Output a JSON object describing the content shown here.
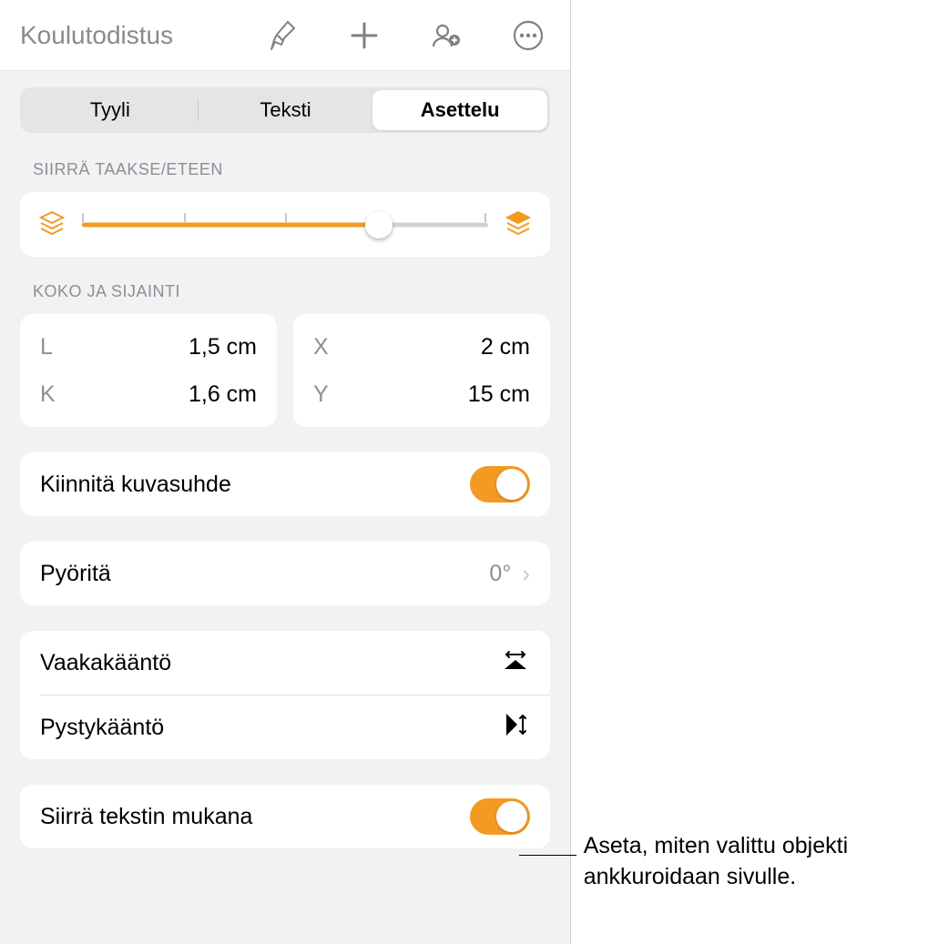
{
  "header": {
    "title": "Koulutodistus",
    "icons": {
      "format": "format-brush-icon",
      "add": "plus-icon",
      "collab": "collaborate-icon",
      "more": "more-icon"
    }
  },
  "tabs": {
    "style": "Tyyli",
    "text": "Teksti",
    "layout": "Asettelu"
  },
  "sections": {
    "move": "SIIRRÄ TAAKSE/ETEEN",
    "size": "KOKO JA SIJAINTI"
  },
  "size": {
    "w_label": "L",
    "w_value": "1,5 cm",
    "h_label": "K",
    "h_value": "1,6 cm",
    "x_label": "X",
    "x_value": "2 cm",
    "y_label": "Y",
    "y_value": "15 cm"
  },
  "rows": {
    "lock_ratio": "Kiinnitä kuvasuhde",
    "rotate": "Pyöritä",
    "rotate_value": "0°",
    "flip_h": "Vaakakääntö",
    "flip_v": "Pystykääntö",
    "move_with_text": "Siirrä tekstin mukana"
  },
  "callout": "Aseta, miten valittu objekti ankkuroidaan sivulle."
}
